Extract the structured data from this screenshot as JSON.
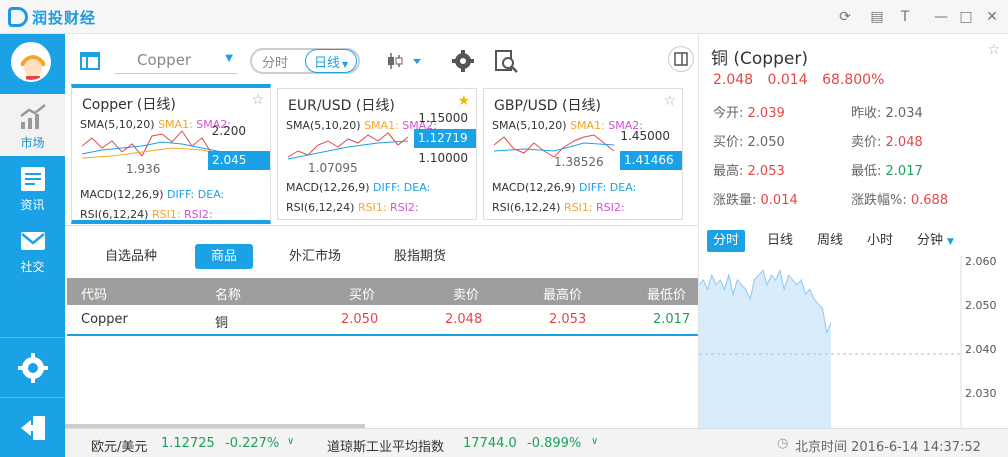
{
  "app": {
    "logo_text": "润投财经"
  },
  "sidebar": {
    "items": [
      {
        "label": "市场"
      },
      {
        "label": "资讯"
      },
      {
        "label": "社交"
      }
    ]
  },
  "toolbar": {
    "product_select": "Copper",
    "period_toggle": [
      "分时",
      "日线"
    ],
    "chart_menu": ""
  },
  "cards": [
    {
      "title": "Copper (日线)",
      "sma": "SMA(5,10,20)",
      "sma1": "SMA1:",
      "sma2": "SMA2:",
      "prices": [
        "2.200",
        "1.936"
      ],
      "box": "2.045",
      "macd": "MACD(12,26,9)",
      "diff": "DIFF:",
      "dea": "DEA:",
      "rsi": "RSI(6,12,24)",
      "rsi1": "RSI1:",
      "rsi2": "RSI2:",
      "starred": false
    },
    {
      "title": "EUR/USD (日线)",
      "sma": "SMA(5,10,20)",
      "sma1": "SMA1:",
      "sma2": "SMA2:",
      "prices": [
        "1.15000",
        "1.10000",
        "1.07095"
      ],
      "box": "1.12719",
      "macd": "MACD(12,26,9)",
      "diff": "DIFF:",
      "dea": "DEA:",
      "rsi": "RSI(6,12,24)",
      "rsi1": "RSI1:",
      "rsi2": "RSI2:",
      "starred": true
    },
    {
      "title": "GBP/USD (日线)",
      "sma": "SMA(5,10,20)",
      "sma1": "SMA1:",
      "sma2": "SMA2:",
      "prices": [
        "1.45000",
        "1.38526"
      ],
      "box": "1.41466",
      "macd": "MACD(12,26,9)",
      "diff": "DIFF:",
      "dea": "DEA:",
      "rsi": "RSI(6,12,24)",
      "rsi1": "RSI1:",
      "rsi2": "RSI2:",
      "starred": false
    }
  ],
  "tabs": [
    "自选品种",
    "商品",
    "外汇市场",
    "股指期货"
  ],
  "table": {
    "headers": [
      "代码",
      "名称",
      "买价",
      "卖价",
      "最高价",
      "最低价"
    ],
    "rows": [
      {
        "code": "Copper",
        "name": "铜",
        "bid": "2.050",
        "ask": "2.048",
        "high": "2.053",
        "low": "2.017"
      }
    ]
  },
  "detail": {
    "title": "铜 (Copper)",
    "price": "2.048",
    "change": "0.014",
    "change_pct": "68.800%",
    "open_label": "今开:",
    "open": "2.039",
    "prev_label": "昨收:",
    "prev": "2.034",
    "bid_label": "买价:",
    "bid": "2.050",
    "ask_label": "卖价:",
    "ask": "2.048",
    "high_label": "最高:",
    "high": "2.053",
    "low_label": "最低:",
    "low": "2.017",
    "chg_label": "涨跌量:",
    "chg": "0.014",
    "chgpct_label": "涨跌幅%:",
    "chgpct": "0.688",
    "periods": [
      "分时",
      "日线",
      "周线",
      "小时",
      "分钟"
    ],
    "y_ticks": [
      "2.060",
      "2.050",
      "2.040",
      "2.030"
    ]
  },
  "footer": {
    "eurusd_label": "欧元/美元",
    "eurusd_value": "1.12725",
    "eurusd_change": "-0.227%",
    "dow_label": "道琼斯工业平均指数",
    "dow_value": "17744.0",
    "dow_change": "-0.899%",
    "clock": "北京时间 2016-6-14 14:37:52"
  },
  "colors": {
    "accent": "#1aa1e6",
    "up": "#e04848",
    "down": "#1ca05a"
  },
  "chart_data": {
    "type": "area",
    "y_ticks": [
      "2.060",
      "2.050",
      "2.040",
      "2.030"
    ],
    "ylim": [
      2.026,
      2.062
    ],
    "values": [
      2.056,
      2.057,
      2.055,
      2.058,
      2.056,
      2.057,
      2.055,
      2.058,
      2.054,
      2.057,
      2.056,
      2.055,
      2.053,
      2.057,
      2.058,
      2.059,
      2.056,
      2.058,
      2.057,
      2.059,
      2.055,
      2.058,
      2.057,
      2.056,
      2.057,
      2.054,
      2.055,
      2.053,
      2.052,
      2.051,
      2.046,
      2.048
    ]
  }
}
